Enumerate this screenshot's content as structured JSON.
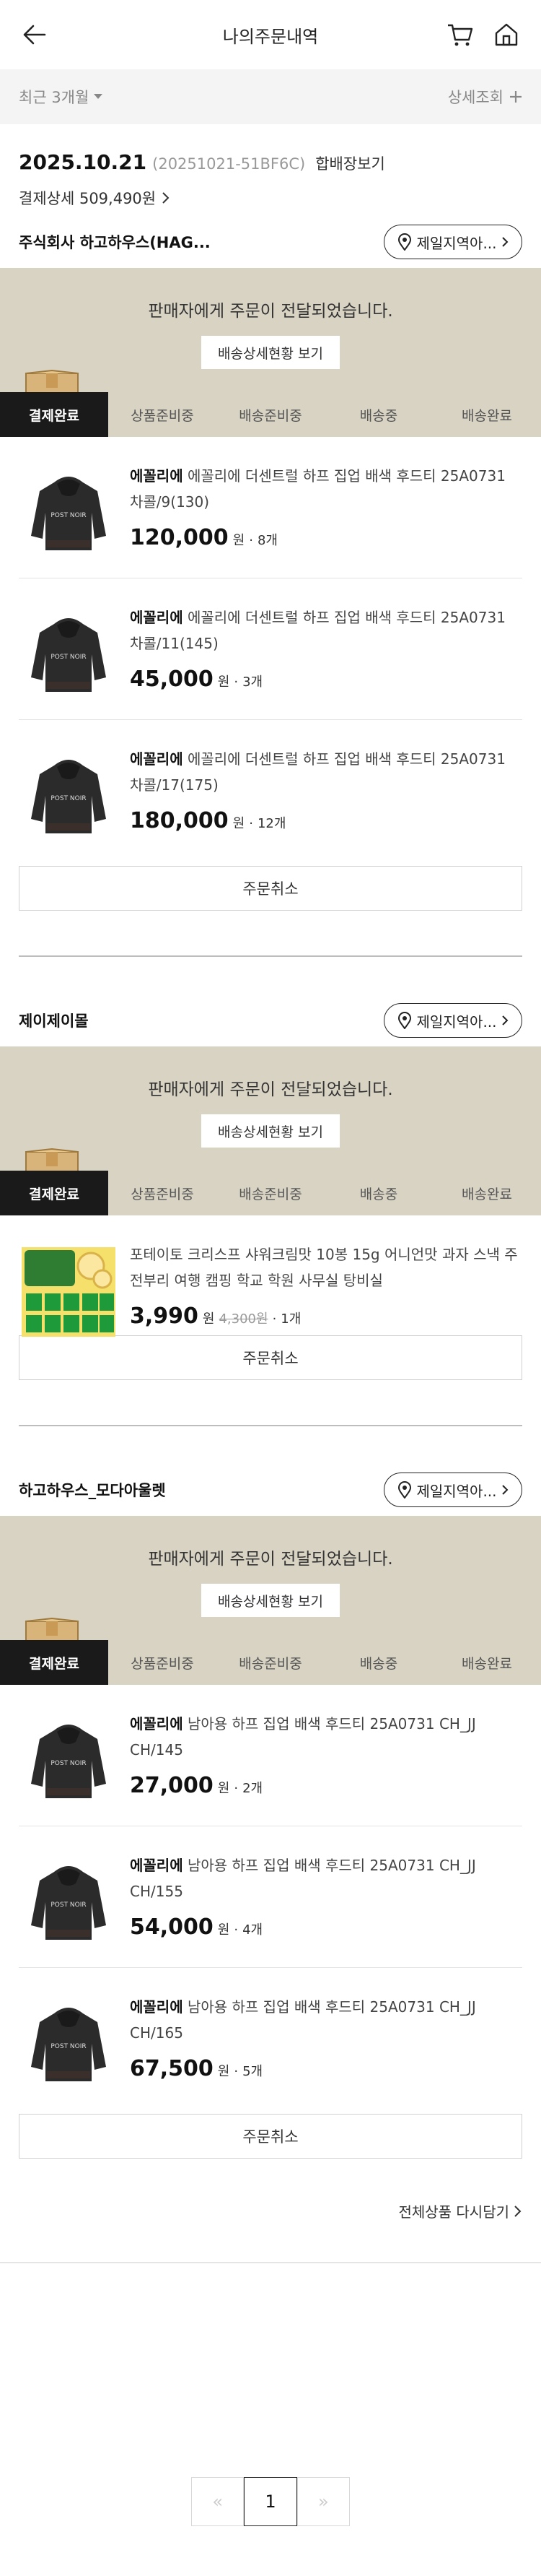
{
  "header": {
    "title": "나의주문내역"
  },
  "filter": {
    "period": "최근 3개월",
    "detail": "상세조회"
  },
  "order": {
    "date": "2025.10.21",
    "order_no": "(20251021-51BF6C)",
    "ship_join": "합배장보기",
    "payment": "결제상세 509,490원"
  },
  "common": {
    "region_btn": "제일지역아...",
    "status_msg": "판매자에게 주문이 전달되었습니다.",
    "view_status": "배송상세현황 보기",
    "steps": [
      "결제완료",
      "상품준비중",
      "배송준비중",
      "배송중",
      "배송완료"
    ],
    "cancel": "주문취소",
    "won": "원"
  },
  "sellers": [
    {
      "name": "주식회사 하고하우스(HAG...",
      "items": [
        {
          "brand": "에꼴리에",
          "name": "에꼴리에 더센트럴 하프 집업 배색 후드티 25A0731 차콜/9(130)",
          "price": "120,000",
          "qty": "8개"
        },
        {
          "brand": "에꼴리에",
          "name": "에꼴리에 더센트럴 하프 집업 배색 후드티 25A0731 차콜/11(145)",
          "price": "45,000",
          "qty": "3개"
        },
        {
          "brand": "에꼴리에",
          "name": "에꼴리에 더센트럴 하프 집업 배색 후드티 25A0731 차콜/17(175)",
          "price": "180,000",
          "qty": "12개"
        }
      ]
    },
    {
      "name": "제이제이몰",
      "items": [
        {
          "brand": "",
          "name": "포테이토 크리스프 샤워크림맛 10봉 15g 어니언맛 과자 스낵 주전부리 여행 캠핑 학교 학원 사무실 탕비실",
          "price": "3,990",
          "orig": "4,300원",
          "qty": "1개"
        }
      ]
    },
    {
      "name": "하고하우스_모다아울렛",
      "items": [
        {
          "brand": "에꼴리에",
          "name": "남아용 하프 집업 배색 후드티 25A0731 CH_JJ CH/145",
          "price": "27,000",
          "qty": "2개"
        },
        {
          "brand": "에꼴리에",
          "name": "남아용 하프 집업 배색 후드티 25A0731 CH_JJ CH/155",
          "price": "54,000",
          "qty": "4개"
        },
        {
          "brand": "에꼴리에",
          "name": "남아용 하프 집업 배색 후드티 25A0731 CH_JJ CH/165",
          "price": "67,500",
          "qty": "5개"
        }
      ]
    }
  ],
  "reorder_all": "전체상품 다시담기",
  "pager": {
    "prev": "«",
    "current": "1",
    "next": "»"
  },
  "colors": {
    "banner": "#d8d3c3",
    "active_step": "#1a1a1a"
  }
}
